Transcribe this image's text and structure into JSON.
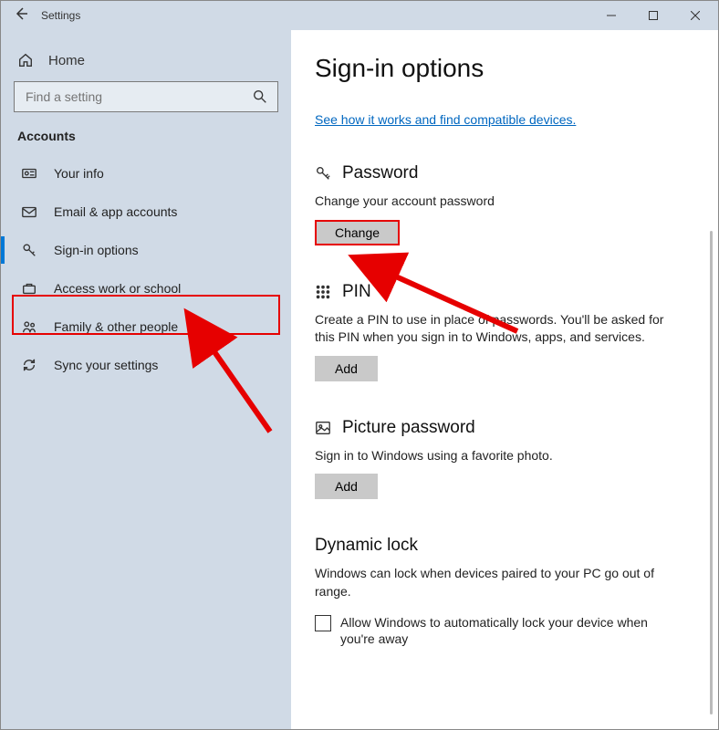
{
  "window": {
    "title": "Settings"
  },
  "sidebar": {
    "home_label": "Home",
    "search_placeholder": "Find a setting",
    "section_label": "Accounts",
    "items": [
      {
        "label": "Your info"
      },
      {
        "label": "Email & app accounts"
      },
      {
        "label": "Sign-in options"
      },
      {
        "label": "Access work or school"
      },
      {
        "label": "Family & other people"
      },
      {
        "label": "Sync your settings"
      }
    ]
  },
  "main": {
    "title": "Sign-in options",
    "help_link": "See how it works and find compatible devices.",
    "password": {
      "heading": "Password",
      "desc": "Change your account password",
      "button": "Change"
    },
    "pin": {
      "heading": "PIN",
      "desc": "Create a PIN to use in place of passwords. You'll be asked for this PIN when you sign in to Windows, apps, and services.",
      "button": "Add"
    },
    "picture": {
      "heading": "Picture password",
      "desc": "Sign in to Windows using a favorite photo.",
      "button": "Add"
    },
    "dynamic": {
      "heading": "Dynamic lock",
      "desc": "Windows can lock when devices paired to your PC go out of range.",
      "checkbox_label": "Allow Windows to automatically lock your device when you're away"
    }
  }
}
